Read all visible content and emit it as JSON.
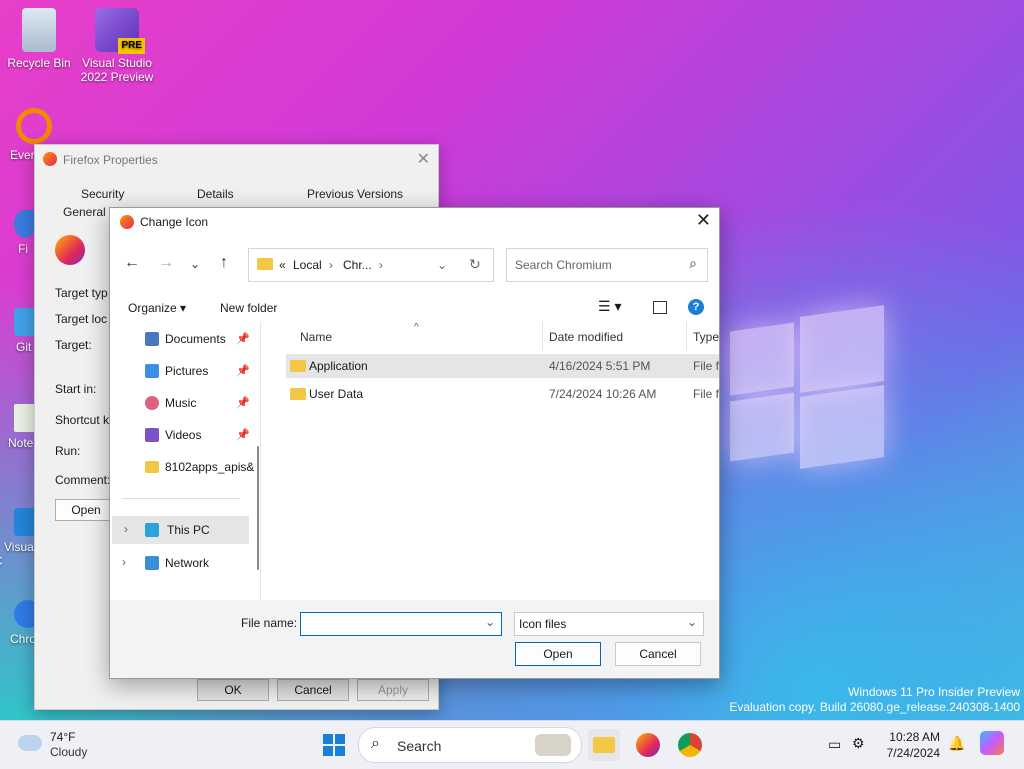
{
  "desktop": {
    "icons": [
      {
        "label": "Recycle Bin"
      },
      {
        "label": "Visual Studio 2022 Preview"
      },
      {
        "label": "Ever"
      },
      {
        "label": "Fi"
      },
      {
        "label": "Git"
      },
      {
        "label": "Note"
      },
      {
        "label": "Visua C"
      },
      {
        "label": "Chro"
      }
    ],
    "watermark_line1": "Windows 11 Pro Insider Preview",
    "watermark_line2": "Evaluation copy. Build 26080.ge_release.240308-1400"
  },
  "properties": {
    "title": "Firefox Properties",
    "tabs_row1": [
      "Security",
      "Details",
      "Previous Versions"
    ],
    "tab_general": "General",
    "labels": [
      "Target typ",
      "Target loc",
      "Target:",
      "Start in:",
      "Shortcut k",
      "Run:",
      "Comment:"
    ],
    "open_button": "Open",
    "ok": "OK",
    "cancel": "Cancel",
    "apply": "Apply"
  },
  "dialog": {
    "title": "Change Icon",
    "address": {
      "prefix": "«",
      "part1": "Local",
      "part2": "Chr..."
    },
    "search_placeholder": "Search Chromium",
    "organize": "Organize ▾",
    "new_folder": "New folder",
    "nav": [
      {
        "label": "Documents",
        "icon": "documents-icon",
        "color": "#4a76c2"
      },
      {
        "label": "Pictures",
        "icon": "pictures-icon",
        "color": "#3a8ee6"
      },
      {
        "label": "Music",
        "icon": "music-icon",
        "color": "#e0607e"
      },
      {
        "label": "Videos",
        "icon": "videos-icon",
        "color": "#7b52c7"
      },
      {
        "label": "8102apps_apis&",
        "icon": "folder-icon",
        "color": "#f2c744"
      }
    ],
    "this_pc": "This PC",
    "network": "Network",
    "columns": {
      "name": "Name",
      "date": "Date modified",
      "type": "Type"
    },
    "files": [
      {
        "name": "Application",
        "date": "4/16/2024 5:51 PM",
        "type": "File fo"
      },
      {
        "name": "User Data",
        "date": "7/24/2024 10:26 AM",
        "type": "File fo"
      }
    ],
    "file_name_label": "File name:",
    "file_name_value": "",
    "file_type": "Icon files",
    "open": "Open",
    "cancel": "Cancel"
  },
  "taskbar": {
    "temp": "74°F",
    "condition": "Cloudy",
    "search": "Search",
    "time": "10:28 AM",
    "date": "7/24/2024"
  }
}
